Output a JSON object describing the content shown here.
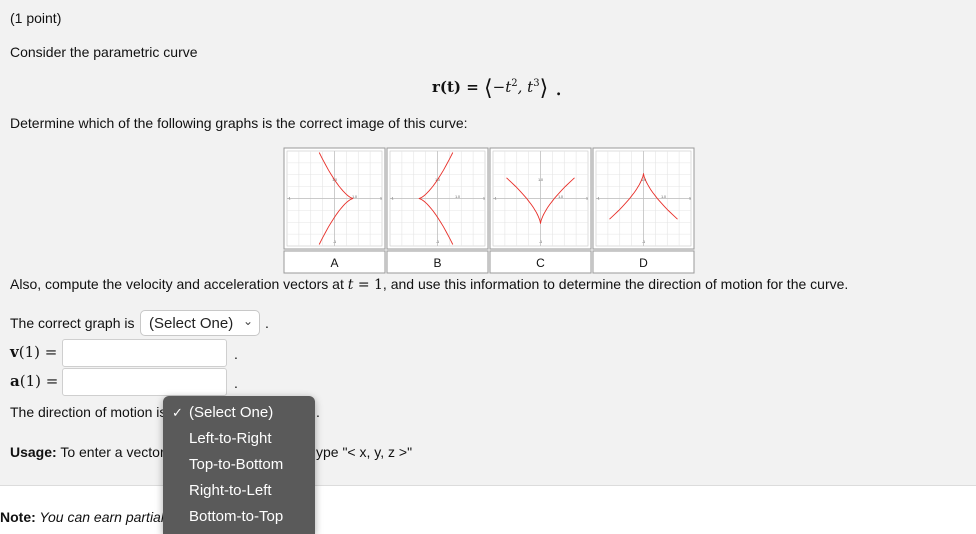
{
  "header": {
    "points": "(1 point)"
  },
  "intro": "Consider the parametric curve",
  "formula": {
    "lhs": "r(t) = ",
    "open": "⟨",
    "part1": "−t",
    "exp1": "2",
    "sep": ", t",
    "exp2": "3",
    "close": "⟩ ."
  },
  "question": "Determine which of the following graphs is the correct image of this curve:",
  "graphs": {
    "labels": [
      "A",
      "B",
      "C",
      "D"
    ],
    "tick_labels": {
      "top": "1.0",
      "right": "1.0",
      "bottom": "-1",
      "left": "-1",
      "x_end": "1"
    },
    "curve_color": "#e8302a"
  },
  "also_text_1": "Also, compute the velocity and acceleration vectors at ",
  "also_t": "t",
  "also_eq": " = 1",
  "also_text_2": ", and use this information to determine the direction of motion for the curve.",
  "correct_graph": {
    "label": "The correct graph is",
    "select_value": "(Select One)",
    "dot": "."
  },
  "velocity": {
    "label_bold": "v",
    "label_rest": "(1) =",
    "value": "",
    "dot": "."
  },
  "acceleration": {
    "label_bold": "a",
    "label_rest": "(1) =",
    "value": "",
    "dot": "."
  },
  "direction": {
    "label": "The direction of motion is",
    "dot": "."
  },
  "usage": {
    "bold": "Usage:",
    "text_before": " To enter a vector",
    "text_after": "ype \"< x, y, z >\""
  },
  "note": {
    "bold": "Note:",
    "text": " You can earn partial"
  },
  "dropdown": {
    "options": [
      "(Select One)",
      "Left-to-Right",
      "Top-to-Bottom",
      "Right-to-Left",
      "Bottom-to-Top"
    ],
    "selected_index": 0,
    "check": "✓"
  }
}
